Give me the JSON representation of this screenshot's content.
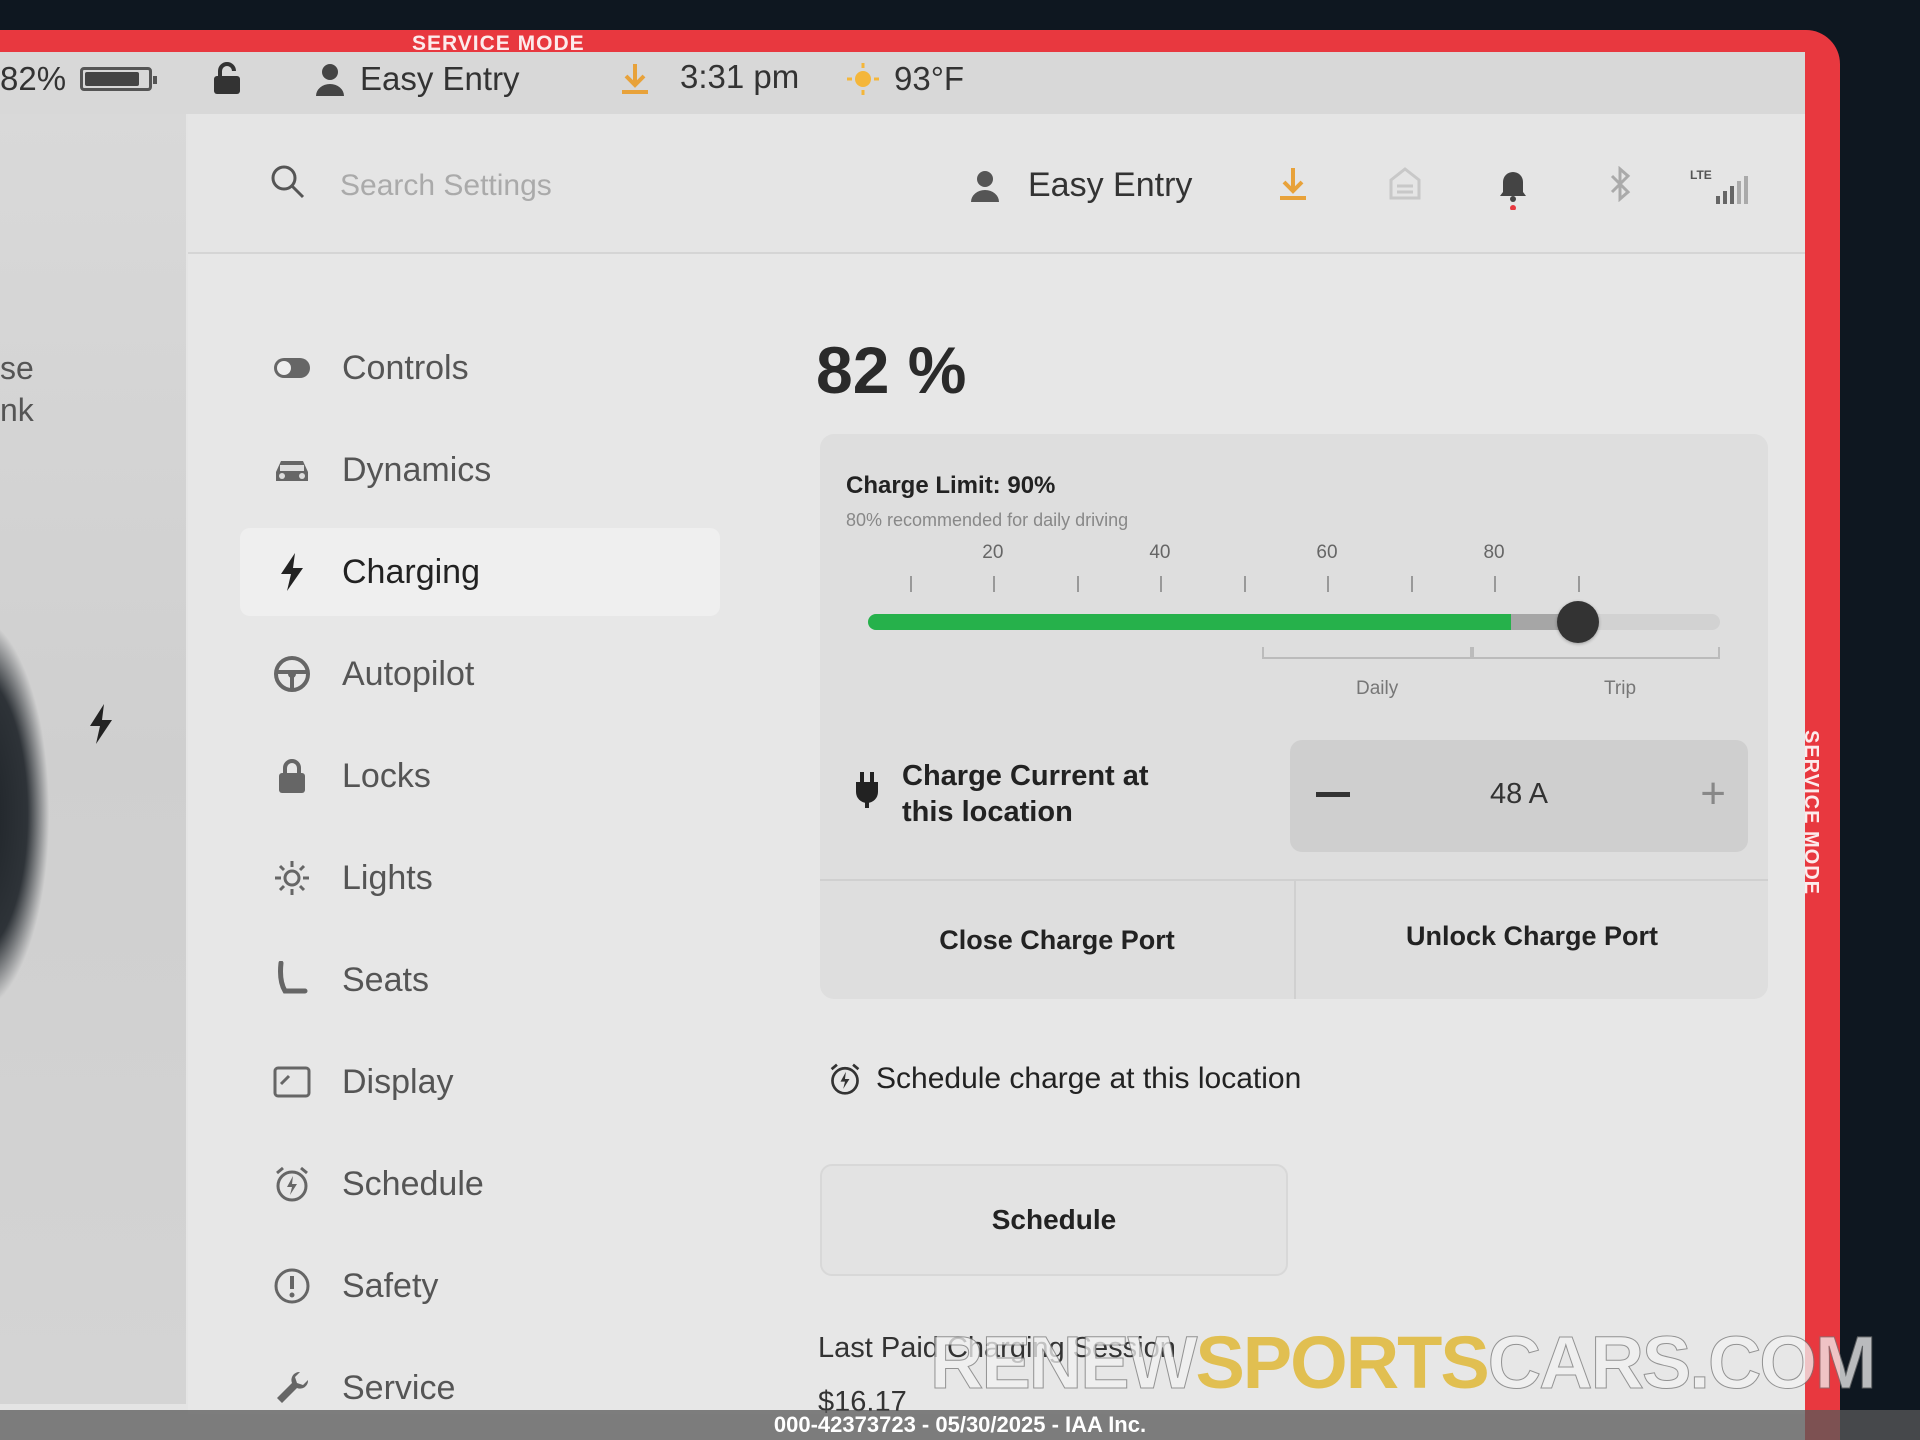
{
  "frame": {
    "service_mode_top": "SERVICE MODE",
    "service_mode_side": "SERVICE MODE",
    "accent_red": "#e8383f"
  },
  "statusbar": {
    "battery_pct": "82%",
    "profile": "Easy Entry",
    "time": "3:31 pm",
    "temperature": "93°F"
  },
  "car_area": {
    "text_line1": "se",
    "text_line2": "nk"
  },
  "header": {
    "search_placeholder": "Search Settings",
    "profile": "Easy Entry",
    "signal_label": "LTE"
  },
  "sidebar": {
    "items": [
      {
        "label": "Controls",
        "icon": "toggle-icon"
      },
      {
        "label": "Dynamics",
        "icon": "car-icon"
      },
      {
        "label": "Charging",
        "icon": "bolt-icon",
        "active": true
      },
      {
        "label": "Autopilot",
        "icon": "steering-wheel-icon"
      },
      {
        "label": "Locks",
        "icon": "lock-icon"
      },
      {
        "label": "Lights",
        "icon": "sun-icon"
      },
      {
        "label": "Seats",
        "icon": "seat-icon"
      },
      {
        "label": "Display",
        "icon": "display-icon"
      },
      {
        "label": "Schedule",
        "icon": "alarm-clock-icon"
      },
      {
        "label": "Safety",
        "icon": "alert-circle-icon"
      },
      {
        "label": "Service",
        "icon": "wrench-icon"
      }
    ]
  },
  "charging": {
    "battery_level": "82 %",
    "charge_limit_label": "Charge Limit: 90%",
    "charge_limit_hint": "80% recommended for daily driving",
    "slider": {
      "current_level": 82,
      "limit": 90,
      "tick_labels": [
        "20",
        "40",
        "60",
        "80"
      ],
      "range_daily": "Daily",
      "range_trip": "Trip",
      "fill_color": "#26b14b"
    },
    "charge_current_label": "Charge Current at this location",
    "charge_current_value": "48 A",
    "minus_label": "—",
    "plus_label": "+",
    "close_port": "Close Charge Port",
    "unlock_port": "Unlock Charge Port",
    "schedule_header": "Schedule charge at this location",
    "schedule_button": "Schedule",
    "last_session_title": "Last Paid Charging Session",
    "last_session_value": "$16.17"
  },
  "watermark": {
    "part1": "RENEW",
    "part2": "SPORTS",
    "part3": "CARS.COM",
    "footer": "000-42373723 - 05/30/2025 - IAA Inc."
  }
}
